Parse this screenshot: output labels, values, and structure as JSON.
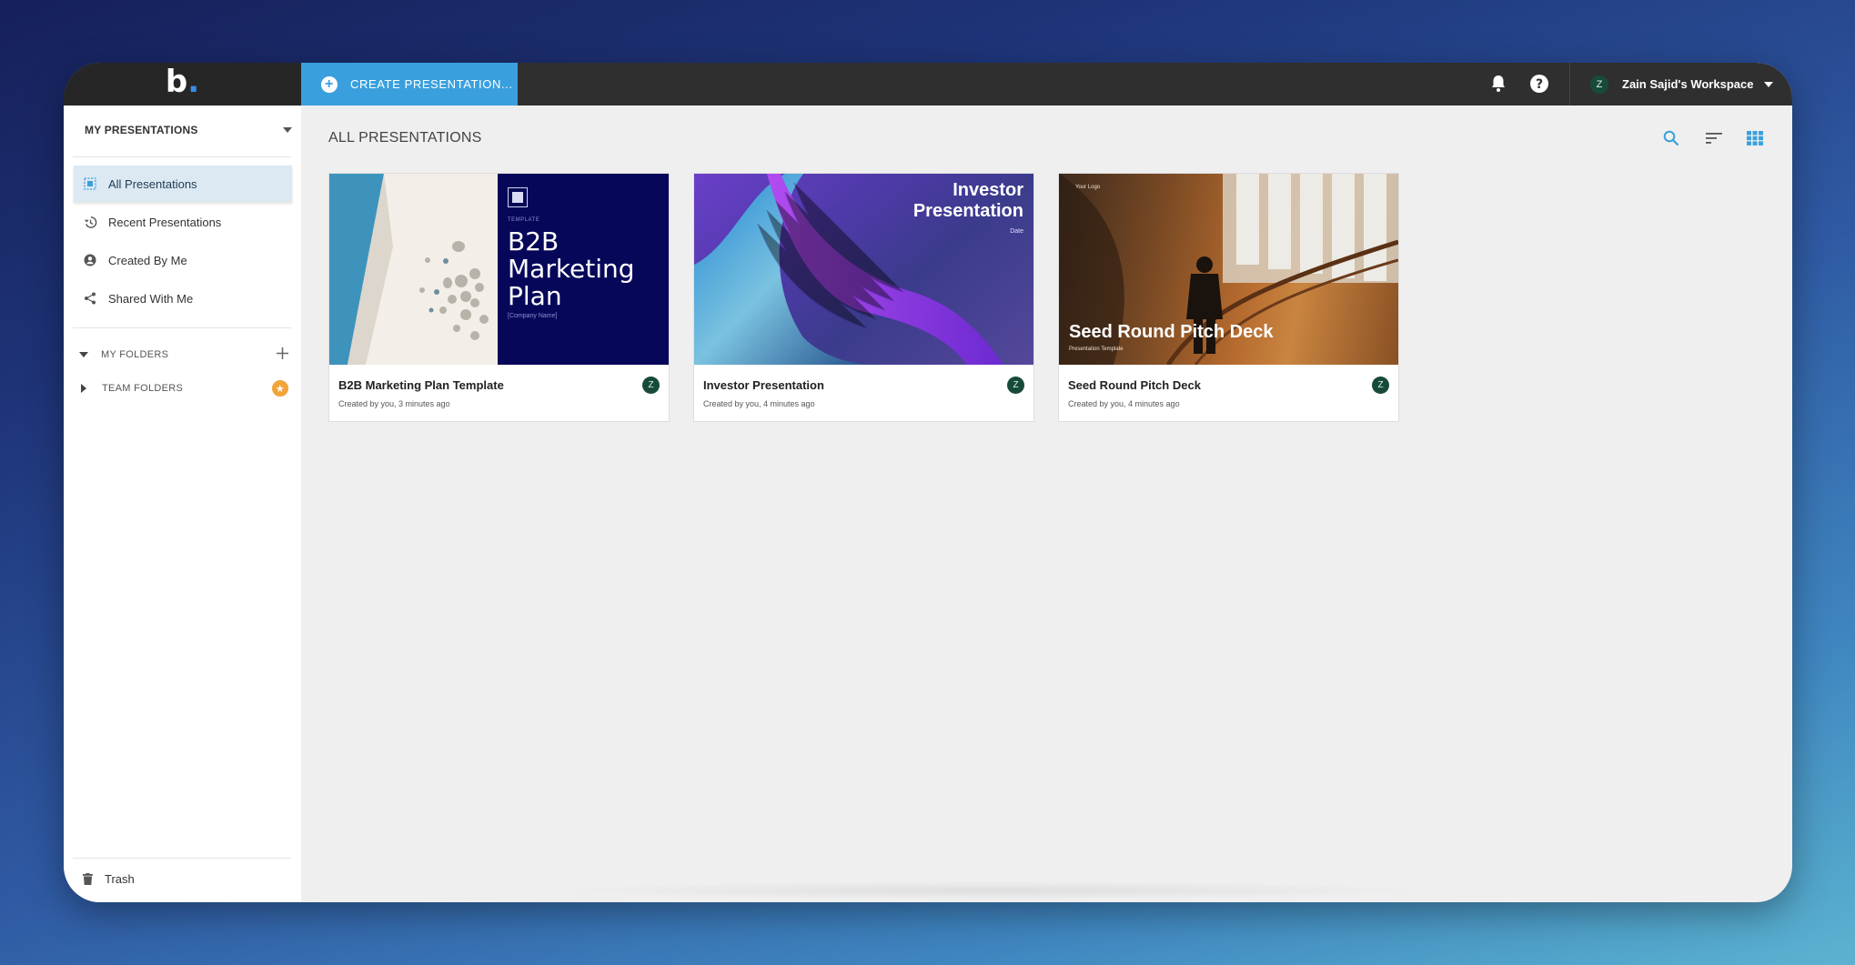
{
  "app": {
    "logo_text": "b",
    "logo_dot": ".",
    "create_button_label": "CREATE PRESENTATION...",
    "workspace_initial": "Z",
    "workspace_name": "Zain Sajid's Workspace",
    "accent_color": "#3aa0dd"
  },
  "sidebar": {
    "header": "MY PRESENTATIONS",
    "items": [
      {
        "label": "All Presentations",
        "icon": "all-presentations-icon",
        "active": true
      },
      {
        "label": "Recent Presentations",
        "icon": "history-icon",
        "active": false
      },
      {
        "label": "Created By Me",
        "icon": "user-icon",
        "active": false
      },
      {
        "label": "Shared With Me",
        "icon": "share-icon",
        "active": false
      }
    ],
    "my_folders_label": "MY FOLDERS",
    "team_folders_label": "TEAM FOLDERS",
    "trash_label": "Trash"
  },
  "main": {
    "title": "ALL PRESENTATIONS",
    "cards": [
      {
        "title": "B2B Marketing Plan Template",
        "meta": "Created by you, 3 minutes ago",
        "owner_initial": "Z",
        "thumb": {
          "tag": "TEMPLATE",
          "heading_line1": "B2B",
          "heading_line2": "Marketing",
          "heading_line3": "Plan",
          "company": "[Company Name]"
        }
      },
      {
        "title": "Investor Presentation",
        "meta": "Created by you, 4 minutes ago",
        "owner_initial": "Z",
        "thumb": {
          "heading_line1": "Investor",
          "heading_line2": "Presentation",
          "date": "Date"
        }
      },
      {
        "title": "Seed Round Pitch Deck",
        "meta": "Created by you, 4 minutes ago",
        "owner_initial": "Z",
        "thumb": {
          "logo": "Your Logo",
          "heading": "Seed Round Pitch Deck",
          "subheading": "Presentation Template"
        }
      }
    ]
  }
}
